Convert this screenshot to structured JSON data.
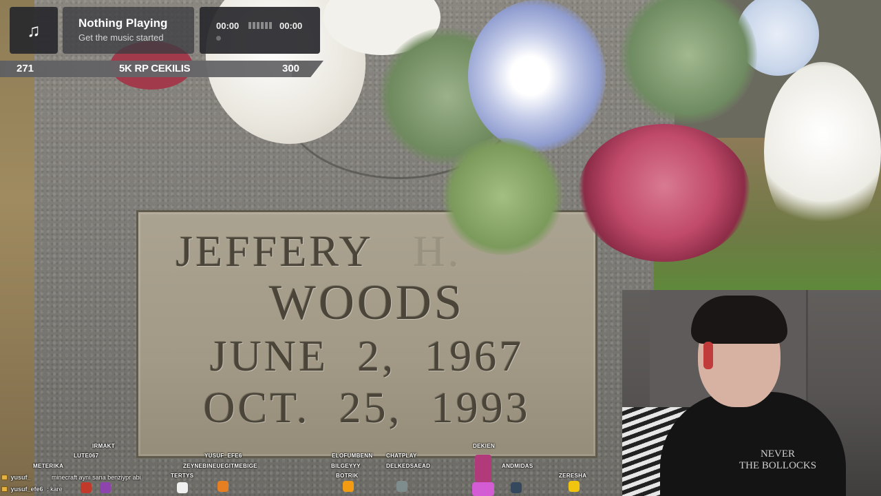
{
  "music": {
    "icon": "music-note-icon",
    "title": "Nothing Playing",
    "subtitle": "Get the music started",
    "time_current": "00:00",
    "time_total": "00:00"
  },
  "goal": {
    "current": "271",
    "title": "5K RP CEKILIS",
    "target": "300",
    "progress_fraction": 0.903
  },
  "headstone": {
    "first_name": "JEFFERY",
    "initial": "H.",
    "last_name": "WOODS",
    "birth_month": "JUNE",
    "birth_day": "2,",
    "birth_year": "1967",
    "death_month": "OCT.",
    "death_day": "25,",
    "death_year": "1993"
  },
  "webcam": {
    "shirt_line1": "NEVER",
    "shirt_line2": "THE BOLLOCKS"
  },
  "viewers": [
    {
      "name": "IRMAKT"
    },
    {
      "name": "LUTE067"
    },
    {
      "name": "METERIKA"
    },
    {
      "name": "YUSUF_EFE6"
    },
    {
      "name": "ZEYNEBINEUEGITMEBIGE"
    },
    {
      "name": "TERTYS"
    },
    {
      "name": "ELOFUMBENN"
    },
    {
      "name": "BILGEYYY"
    },
    {
      "name": "BOTRIK"
    },
    {
      "name": "CHATPLAY"
    },
    {
      "name": "DELKEDSAEAD"
    },
    {
      "name": "DEKIEN"
    },
    {
      "name": "ANDMIDAS"
    },
    {
      "name": "ZERESHA"
    }
  ],
  "chat": [
    {
      "user": "yusuf_",
      "message": "minecraft aynı sana benziypr abi"
    },
    {
      "user": "yusuf_efe6",
      "message": ": kare"
    }
  ],
  "colors": {
    "widget_dark": "#28282c",
    "widget_mid": "#3c3c40",
    "text_white": "#ffffff",
    "headset_red": "#c23b3b"
  }
}
